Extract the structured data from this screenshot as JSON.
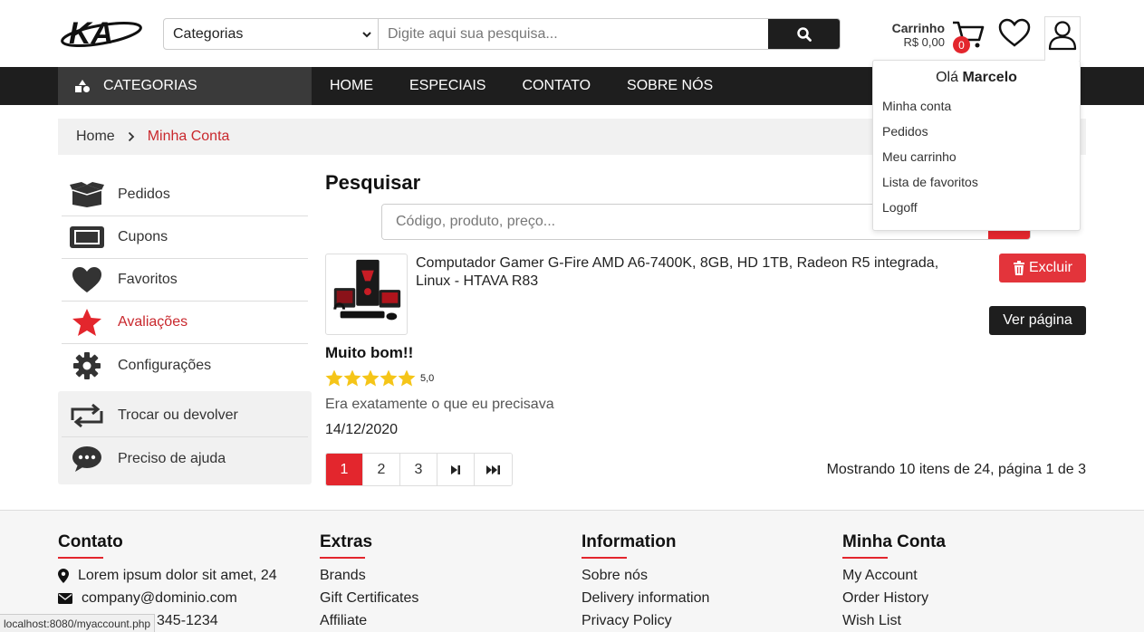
{
  "header": {
    "logo_text": "KA",
    "category_select": "Categorias",
    "search_placeholder": "Digite aqui sua pesquisa...",
    "cart_title": "Carrinho",
    "cart_total": "R$ 0,00",
    "cart_count": "0"
  },
  "nav": {
    "categories_label": "CATEGORIAS",
    "links": [
      "HOME",
      "ESPECIAIS",
      "CONTATO",
      "SOBRE NÓS"
    ]
  },
  "breadcrumb": {
    "home": "Home",
    "current": "Minha Conta"
  },
  "sidebar": {
    "items": [
      {
        "label": "Pedidos",
        "icon": "box-icon"
      },
      {
        "label": "Cupons",
        "icon": "ticket-icon"
      },
      {
        "label": "Favoritos",
        "icon": "heart-icon"
      },
      {
        "label": "Avaliações",
        "icon": "star-icon",
        "active": true
      },
      {
        "label": "Configurações",
        "icon": "gear-icon"
      }
    ],
    "extra_items": [
      {
        "label": "Trocar ou devolver",
        "icon": "exchange-icon"
      },
      {
        "label": "Preciso de ajuda",
        "icon": "chat-icon"
      }
    ]
  },
  "main": {
    "title": "Pesquisar",
    "search_placeholder": "Código, produto, preço...",
    "review": {
      "product_name": "Computador Gamer G-Fire AMD A6-7400K, 8GB, HD 1TB, Radeon R5 integrada, Linux - HTAVA R83",
      "delete_label": "Excluir",
      "view_label": "Ver página",
      "title": "Muito bom!!",
      "rating": "5,0",
      "stars": 5,
      "text": "Era exatamente o que eu precisava",
      "date": "14/12/2020"
    },
    "pagination": {
      "pages": [
        "1",
        "2",
        "3"
      ],
      "active": "1",
      "info": "Mostrando 10 itens de 24, página 1 de 3"
    }
  },
  "user_menu": {
    "greeting": "Olá",
    "user_name": "Marcelo",
    "items": [
      "Minha conta",
      "Pedidos",
      "Meu carrinho",
      "Lista de favoritos",
      "Logoff"
    ]
  },
  "footer": {
    "contato": {
      "title": "Contato",
      "address": "Lorem ipsum dolor sit amet, 24",
      "email": "company@dominio.com",
      "phone": "345-1234"
    },
    "extras": {
      "title": "Extras",
      "items": [
        "Brands",
        "Gift Certificates",
        "Affiliate"
      ]
    },
    "information": {
      "title": "Information",
      "items": [
        "Sobre nós",
        "Delivery information",
        "Privacy Policy"
      ]
    },
    "account": {
      "title": "Minha Conta",
      "items": [
        "My Account",
        "Order History",
        "Wish List"
      ]
    }
  },
  "status_bar": "localhost:8080/myaccount.php",
  "colors": {
    "accent": "#e3262d",
    "dark": "#1e1e1e"
  }
}
